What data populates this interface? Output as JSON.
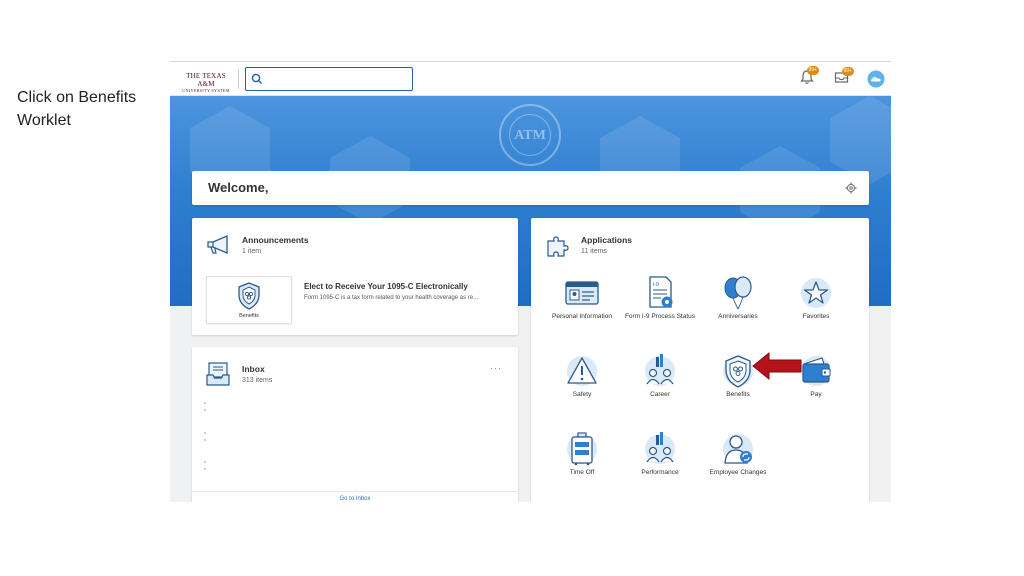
{
  "instruction": "Click on Benefits Worklet",
  "header": {
    "logo_line1": "THE TEXAS A&M",
    "logo_line2": "UNIVERSITY SYSTEM",
    "search_value": "",
    "notifications_count": "99+",
    "inbox_count": "99+"
  },
  "hero": {
    "seal_text": "ATM"
  },
  "welcome": {
    "text": "Welcome,"
  },
  "announcements": {
    "title": "Announcements",
    "count": "1 item",
    "tile_label": "Benefits",
    "item_title": "Elect to Receive Your 1095-C Electronically",
    "item_body": "Form 1095-C is a tax form related to your health coverage as re..."
  },
  "inbox": {
    "title": "Inbox",
    "count": "313 items",
    "more": "···",
    "link": "Go to Inbox"
  },
  "applications": {
    "title": "Applications",
    "count": "11 items",
    "items": [
      {
        "label": "Personal Information",
        "icon": "id-card-icon"
      },
      {
        "label": "Form I-9 Process Status",
        "icon": "form-document-icon"
      },
      {
        "label": "Anniversaries",
        "icon": "balloons-icon"
      },
      {
        "label": "Favorites",
        "icon": "star-icon"
      },
      {
        "label": "Safety",
        "icon": "warning-triangle-icon"
      },
      {
        "label": "Career",
        "icon": "career-people-chart-icon"
      },
      {
        "label": "Benefits",
        "icon": "benefits-shield-icon"
      },
      {
        "label": "Pay",
        "icon": "wallet-icon"
      },
      {
        "label": "Time Off",
        "icon": "suitcase-icon"
      },
      {
        "label": "Performance",
        "icon": "performance-people-chart-icon"
      },
      {
        "label": "Employee Changes",
        "icon": "employee-changes-icon"
      }
    ]
  },
  "colors": {
    "accent": "#2f7fd0",
    "arrow": "#b5121b",
    "brand": "#5a0c1b",
    "badge": "#e38a16"
  }
}
